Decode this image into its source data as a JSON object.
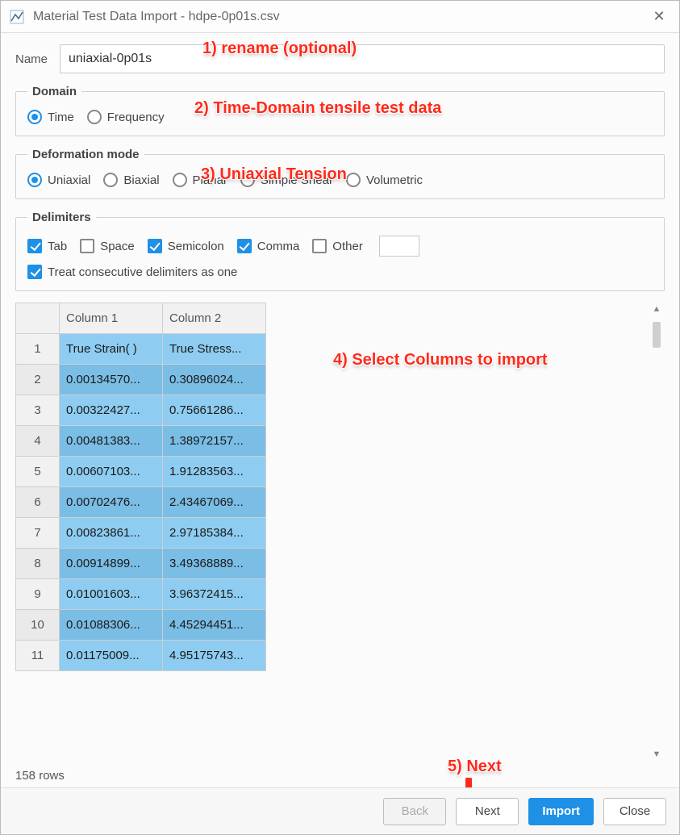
{
  "window": {
    "title": "Material Test Data Import - hdpe-0p01s.csv",
    "close_glyph": "✕"
  },
  "name": {
    "label": "Name",
    "value": "uniaxial-0p01s"
  },
  "domain": {
    "legend": "Domain",
    "options": {
      "time": "Time",
      "frequency": "Frequency"
    },
    "selected": "time"
  },
  "deformation": {
    "legend": "Deformation mode",
    "options": {
      "uniaxial": "Uniaxial",
      "biaxial": "Biaxial",
      "planar": "Planar",
      "simple_shear": "Simple Shear",
      "volumetric": "Volumetric"
    },
    "selected": "uniaxial"
  },
  "delimiters": {
    "legend": "Delimiters",
    "tab": "Tab",
    "space": "Space",
    "semicolon": "Semicolon",
    "comma": "Comma",
    "other": "Other",
    "treat_consecutive": "Treat consecutive delimiters as one",
    "checked": {
      "tab": true,
      "space": false,
      "semicolon": true,
      "comma": true,
      "other": false,
      "treat": true
    }
  },
  "table": {
    "headers": {
      "col1": "Column 1",
      "col2": "Column 2"
    },
    "rows": [
      {
        "n": "1",
        "c1": "True Strain( )",
        "c2": "True Stress..."
      },
      {
        "n": "2",
        "c1": "0.00134570...",
        "c2": "0.30896024..."
      },
      {
        "n": "3",
        "c1": "0.00322427...",
        "c2": "0.75661286..."
      },
      {
        "n": "4",
        "c1": "0.00481383...",
        "c2": "1.38972157..."
      },
      {
        "n": "5",
        "c1": "0.00607103...",
        "c2": "1.91283563..."
      },
      {
        "n": "6",
        "c1": "0.00702476...",
        "c2": "2.43467069..."
      },
      {
        "n": "7",
        "c1": "0.00823861...",
        "c2": "2.97185384..."
      },
      {
        "n": "8",
        "c1": "0.00914899...",
        "c2": "3.49368889..."
      },
      {
        "n": "9",
        "c1": "0.01001603...",
        "c2": "3.96372415..."
      },
      {
        "n": "10",
        "c1": "0.01088306...",
        "c2": "4.45294451..."
      },
      {
        "n": "11",
        "c1": "0.01175009...",
        "c2": "4.95175743..."
      }
    ],
    "rowcount": "158 rows"
  },
  "footer": {
    "back": "Back",
    "next": "Next",
    "import": "Import",
    "close": "Close"
  },
  "annotations": {
    "a1": "1) rename (optional)",
    "a2": "2) Time-Domain tensile test data",
    "a3": "3) Uniaxial Tension",
    "a4": "4) Select Columns to import",
    "a5": "5) Next"
  }
}
